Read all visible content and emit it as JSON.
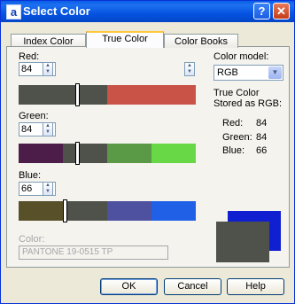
{
  "window": {
    "title": "Select Color",
    "icon_letter": "a",
    "help_glyph": "?",
    "close_glyph": "✕"
  },
  "tabs": [
    {
      "label": "Index Color",
      "active": false
    },
    {
      "label": "True Color",
      "active": true
    },
    {
      "label": "Color Books",
      "active": false
    }
  ],
  "red": {
    "label": "Red:",
    "value": "84",
    "thumb_fraction": 0.33,
    "bar_colors": [
      "#4e524b",
      "#c95347"
    ]
  },
  "green": {
    "label": "Green:",
    "value": "84",
    "thumb_fraction": 0.33,
    "bar_colors": [
      "#4b1d48",
      "#4e524b",
      "#5a9a46",
      "#68d846"
    ]
  },
  "blue": {
    "label": "Blue:",
    "value": "66",
    "thumb_fraction": 0.26,
    "bar_colors": [
      "#575028",
      "#4e524b",
      "#4d51a0",
      "#2060e6"
    ]
  },
  "color_model": {
    "label": "Color model:",
    "value": "RGB"
  },
  "stored": {
    "heading": "True Color Stored as RGB:",
    "rows": [
      {
        "name": "Red:",
        "value": "84"
      },
      {
        "name": "Green:",
        "value": "84"
      },
      {
        "name": "Blue:",
        "value": "66"
      }
    ]
  },
  "color": {
    "label": "Color:",
    "value": "PANTONE 19-0515 TP"
  },
  "preview": {
    "new_color": "#4e524b",
    "old_color": "#1020d0"
  },
  "buttons": {
    "ok": "OK",
    "cancel": "Cancel",
    "help": "Help"
  }
}
